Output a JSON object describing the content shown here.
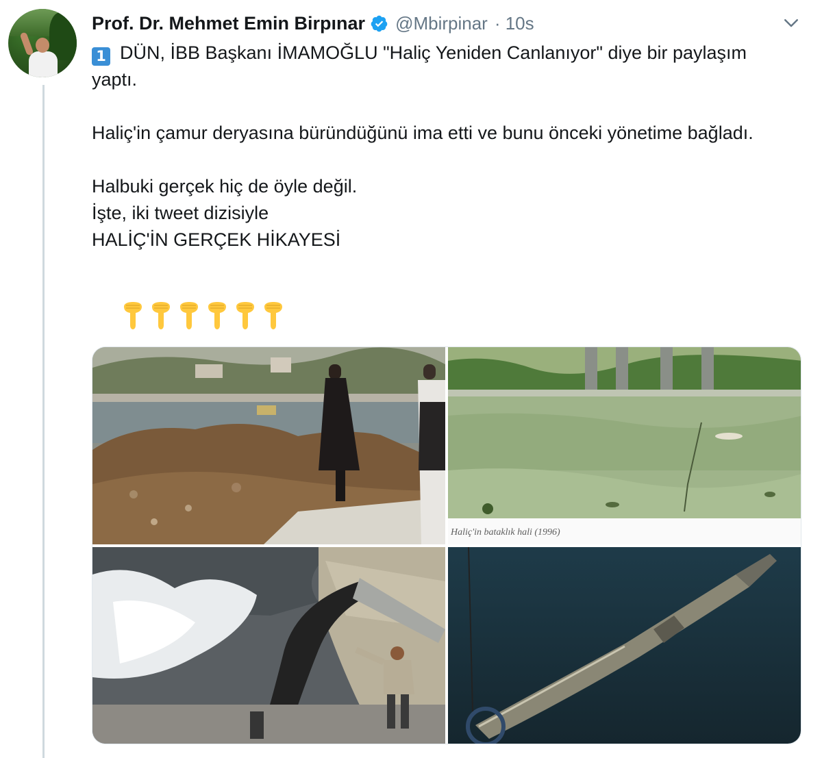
{
  "author": {
    "name": "Prof. Dr. Mehmet Emin Birpınar",
    "handle": "@Mbirpinar",
    "time": "· 10s",
    "verified": true
  },
  "tweet": {
    "number_badge": "1",
    "line1": "DÜN, İBB Başkanı İMAMOĞLU \"Haliç Yeniden Canlanıyor\" diye bir paylaşım yaptı.",
    "line2": "Haliç'in çamur deryasına büründüğünü ima etti ve bunu önceki yönetime bağladı.",
    "line3": "Halbuki gerçek hiç de öyle değil.",
    "line4": "İşte, iki tweet dizisiyle",
    "line5": "HALİÇ'İN GERÇEK HİKAYESİ"
  },
  "emoji_row": [
    "pointing-down",
    "pointing-down",
    "pointing-down",
    "pointing-down",
    "pointing-down",
    "pointing-down"
  ],
  "media": {
    "photo2_caption": "Haliç'in bataklık hali (1996)"
  },
  "colors": {
    "verified_blue": "#1da1f2",
    "secondary_text": "#657786",
    "keycap_blue": "#3a8fd6",
    "emoji_yellow": "#ffc83d"
  }
}
